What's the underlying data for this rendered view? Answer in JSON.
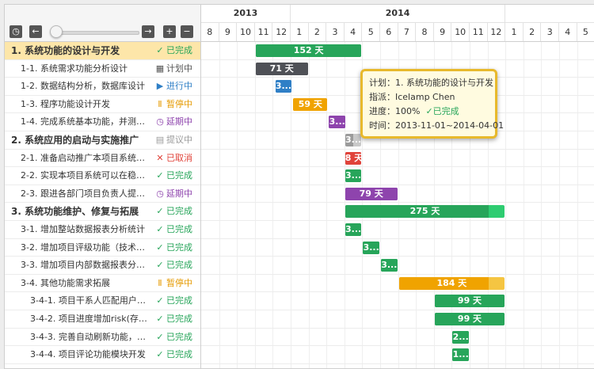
{
  "toolbar": {
    "buttons": [
      {
        "name": "clock-icon",
        "glyph": "◷"
      },
      {
        "name": "arrow-left-icon",
        "glyph": "←"
      },
      {
        "name": "arrow-right-icon",
        "glyph": "→"
      },
      {
        "name": "zoom-in-icon",
        "glyph": "+"
      },
      {
        "name": "zoom-out-icon",
        "glyph": "−"
      }
    ],
    "slider_value": 0
  },
  "timeline": {
    "years": [
      {
        "label": "2013"
      },
      {
        "label": "2014"
      },
      {
        "label": ""
      }
    ],
    "months": [
      "8",
      "9",
      "10",
      "11",
      "12",
      "1",
      "2",
      "3",
      "4",
      "5",
      "6",
      "7",
      "8",
      "9",
      "10",
      "11",
      "12",
      "1",
      "2",
      "3",
      "4",
      "5"
    ]
  },
  "colors": {
    "green": "#27a55a",
    "green_light": "#2ecc71",
    "dark": "#4f5157",
    "blue": "#2f7fc6",
    "orange": "#f0a300",
    "purple": "#8e44ad",
    "gray": "#9b9b9b",
    "red": "#e0433a",
    "highlight": "#fde6a9"
  },
  "tasks": [
    {
      "name": "1. 系统功能的设计与开发",
      "status": "已完成",
      "status_icon": "check-icon",
      "level": 1
    },
    {
      "name": "1-1. 系统需求功能分析设计",
      "status": "计划中",
      "status_icon": "calendar-icon",
      "level": 2
    },
    {
      "name": "1-2. 数据结构分析，数据库设计",
      "status": "进行中",
      "status_icon": "play-circle-icon",
      "level": 2
    },
    {
      "name": "1-3. 程序功能设计开发",
      "status": "暂停中",
      "status_icon": "pause-circle-icon",
      "level": 2
    },
    {
      "name": "1-4. 完成系统基本功能，并测试…",
      "status": "延期中",
      "status_icon": "alarm-icon",
      "level": 2
    },
    {
      "name": "2. 系统应用的启动与实施推广",
      "status": "提议中",
      "status_icon": "document-icon",
      "level": 1
    },
    {
      "name": "2-1. 准备启动推广本项目系统，…",
      "status": "已取消",
      "status_icon": "cross-icon",
      "level": 2
    },
    {
      "name": "2-2. 实现本项目系统可以在稳定…",
      "status": "已完成",
      "status_icon": "check-icon",
      "level": 2
    },
    {
      "name": "2-3. 跟进各部门项目负责人提交…",
      "status": "延期中",
      "status_icon": "alarm-icon",
      "level": 2
    },
    {
      "name": "3. 系统功能维护、修复与拓展",
      "status": "已完成",
      "status_icon": "check-icon",
      "level": 1
    },
    {
      "name": "3-1. 增加整站数据报表分析统计",
      "status": "已完成",
      "status_icon": "check-icon",
      "level": 2
    },
    {
      "name": "3-2. 增加项目评级功能（技术阶…",
      "status": "已完成",
      "status_icon": "check-icon",
      "level": 2
    },
    {
      "name": "3-3. 增加项目内部数据报表分析…",
      "status": "已完成",
      "status_icon": "check-icon",
      "level": 2
    },
    {
      "name": "3-4. 其他功能需求拓展",
      "status": "暂停中",
      "status_icon": "pause-circle-icon",
      "level": 2
    },
    {
      "name": "3-4-1. 项目干系人匹配用户相…",
      "status": "已完成",
      "status_icon": "check-icon",
      "level": 3
    },
    {
      "name": "3-4-2. 项目进度增加risk(存在…",
      "status": "已完成",
      "status_icon": "check-icon",
      "level": 3
    },
    {
      "name": "3-4-3. 完善自动刷新功能，提…",
      "status": "已完成",
      "status_icon": "check-icon",
      "level": 3
    },
    {
      "name": "3-4-4. 项目评论功能模块开发",
      "status": "已完成",
      "status_icon": "check-icon",
      "level": 3
    }
  ],
  "bars": [
    {
      "label": "152 天",
      "start_month": 3.0,
      "end_month": 9.0,
      "color": "green",
      "progress": 1.0
    },
    {
      "label": "71 天",
      "start_month": 3.0,
      "end_month": 6.0,
      "color": "dark",
      "progress": 1.0
    },
    {
      "label": "3...",
      "start_month": 4.1,
      "end_month": 5.1,
      "color": "blue",
      "progress": 1.0
    },
    {
      "label": "59 天",
      "start_month": 5.1,
      "end_month": 7.1,
      "color": "orange",
      "progress": 1.0
    },
    {
      "label": "3...",
      "start_month": 7.1,
      "end_month": 8.1,
      "color": "purple",
      "progress": 1.0
    },
    {
      "label": "3...",
      "start_month": 8.0,
      "end_month": 9.0,
      "color": "gray",
      "progress": 0.5
    },
    {
      "label": "8 天",
      "start_month": 8.0,
      "end_month": 9.0,
      "color": "red",
      "progress": 1.0
    },
    {
      "label": "3...",
      "start_month": 8.0,
      "end_month": 9.0,
      "color": "green",
      "progress": 1.0
    },
    {
      "label": "79 天",
      "start_month": 8.0,
      "end_month": 11.0,
      "color": "purple",
      "progress": 1.0
    },
    {
      "label": "275 天",
      "start_month": 8.0,
      "end_month": 17.0,
      "color": "green_light",
      "progress": 0.9
    },
    {
      "label": "3...",
      "start_month": 8.0,
      "end_month": 9.0,
      "color": "green",
      "progress": 1.0
    },
    {
      "label": "3...",
      "start_month": 9.0,
      "end_month": 10.0,
      "color": "green",
      "progress": 1.0
    },
    {
      "label": "3...",
      "start_month": 10.0,
      "end_month": 11.0,
      "color": "green",
      "progress": 1.0
    },
    {
      "label": "184 天",
      "start_month": 11.0,
      "end_month": 17.0,
      "color": "orange",
      "progress": 0.85
    },
    {
      "label": "99 天",
      "start_month": 13.0,
      "end_month": 17.0,
      "color": "green",
      "progress": 1.0
    },
    {
      "label": "99 天",
      "start_month": 13.0,
      "end_month": 17.0,
      "color": "green",
      "progress": 1.0
    },
    {
      "label": "2...",
      "start_month": 14.0,
      "end_month": 15.0,
      "color": "green",
      "progress": 1.0
    },
    {
      "label": "1...",
      "start_month": 14.0,
      "end_month": 15.0,
      "color": "green",
      "progress": 1.0
    }
  ],
  "tooltip": {
    "plan": "计划：1. 系统功能的设计与开发",
    "assignee": "指派：Icelamp Chen",
    "progress_prefix": "进度：100%",
    "progress_status": "已完成",
    "time": "时间：2013-11-01~2014-04-01"
  }
}
